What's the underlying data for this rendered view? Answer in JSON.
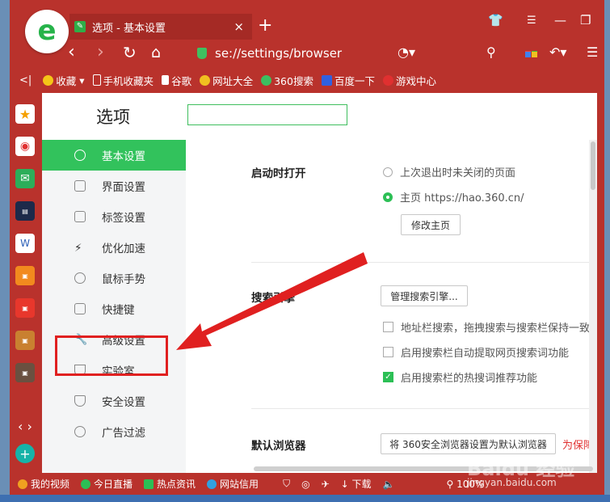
{
  "tab": {
    "title": "选项 - 基本设置"
  },
  "address": {
    "url": "se://settings/browser"
  },
  "bookmarks": [
    {
      "label": "收藏",
      "color": "#f5c518"
    },
    {
      "label": "手机收藏夹",
      "color": "#ffffff"
    },
    {
      "label": "谷歌",
      "color": "#ffffff"
    },
    {
      "label": "网址大全",
      "color": "#f0c020"
    },
    {
      "label": "360搜索",
      "color": "#3cbf60"
    },
    {
      "label": "百度一下",
      "color": "#3060e0"
    },
    {
      "label": "游戏中心",
      "color": "#e03030"
    }
  ],
  "page": {
    "title": "选项"
  },
  "sidebar": {
    "items": [
      {
        "label": "基本设置",
        "active": true
      },
      {
        "label": "界面设置"
      },
      {
        "label": "标签设置"
      },
      {
        "label": "优化加速"
      },
      {
        "label": "鼠标手势"
      },
      {
        "label": "快捷键"
      },
      {
        "label": "高级设置"
      },
      {
        "label": "实验室"
      },
      {
        "label": "安全设置"
      },
      {
        "label": "广告过滤"
      }
    ]
  },
  "startup": {
    "title": "启动时打开",
    "option1": "上次退出时未关闭的页面",
    "option2": "主页  https://hao.360.cn/",
    "button": "修改主页"
  },
  "search_engine": {
    "title": "搜索引擎",
    "button": "管理搜索引擎...",
    "check1": "地址栏搜索，拖拽搜索与搜索栏保持一致",
    "check2": "启用搜索栏自动提取网页搜索词功能",
    "check3": "启用搜索栏的热搜词推荐功能"
  },
  "default_browser": {
    "title": "默认浏览器",
    "button": "将 360安全浏览器设置为默认浏览器",
    "link": "为保障"
  },
  "status": {
    "items": [
      "我的视频",
      "今日直播",
      "热点资讯",
      "网站信用"
    ],
    "download": "下载",
    "zoom": "100%"
  },
  "watermark": {
    "site": "jingyan.baidu.com"
  },
  "colors": {
    "accent": "#32c25c",
    "frame": "#b9322c",
    "arrow": "#e02020"
  }
}
